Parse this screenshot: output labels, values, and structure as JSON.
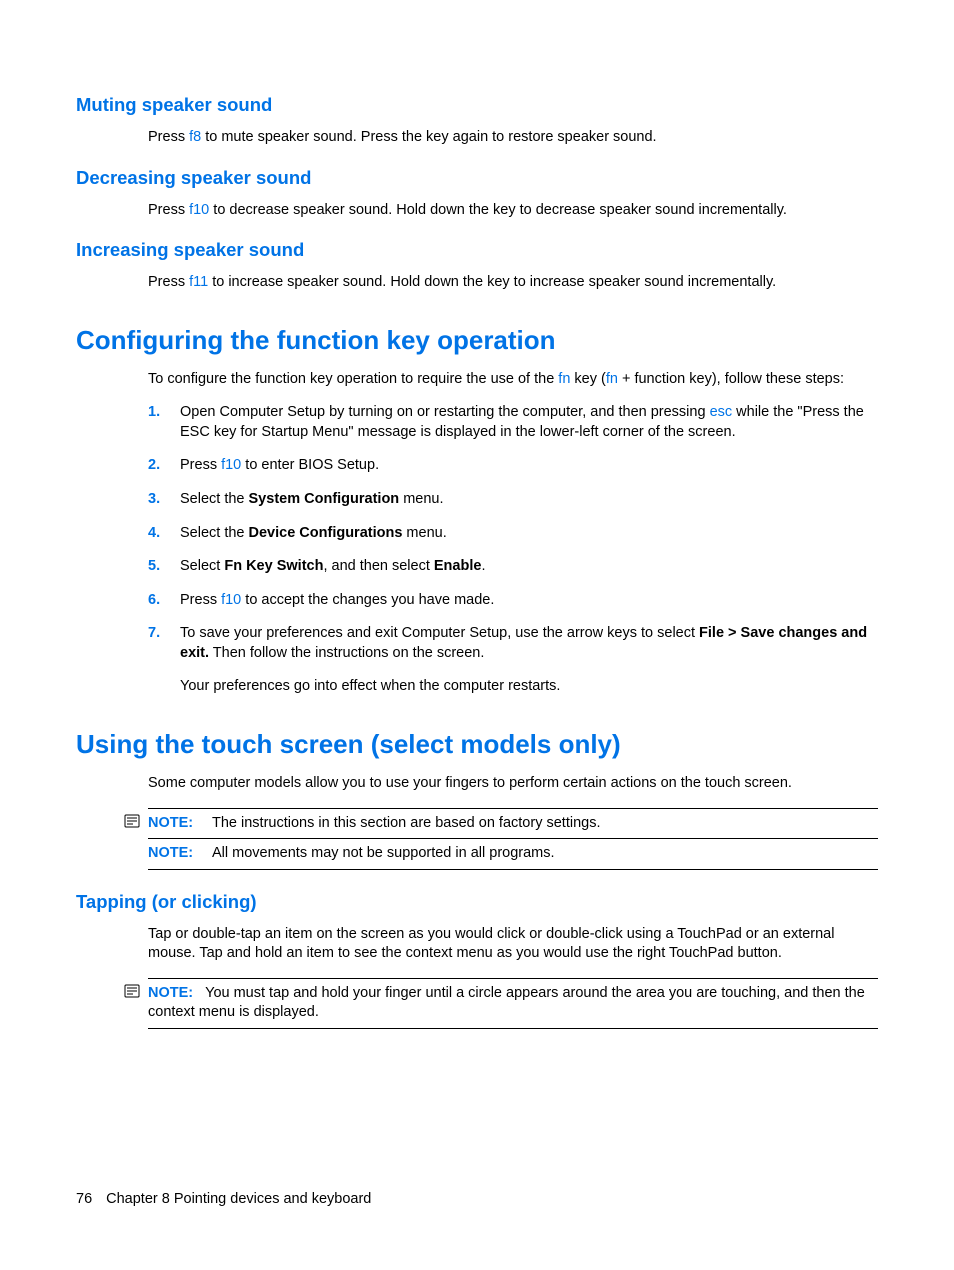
{
  "sections": {
    "muting": {
      "heading": "Muting speaker sound",
      "p1a": "Press ",
      "p1key": "f8",
      "p1b": " to mute speaker sound. Press the key again to restore speaker sound."
    },
    "decreasing": {
      "heading": "Decreasing speaker sound",
      "p1a": "Press ",
      "p1key": "f10",
      "p1b": " to decrease speaker sound. Hold down the key to decrease speaker sound incrementally."
    },
    "increasing": {
      "heading": "Increasing speaker sound",
      "p1a": "Press ",
      "p1key": "f11",
      "p1b": " to increase speaker sound. Hold down the key to increase speaker sound incrementally."
    },
    "configuring": {
      "heading": "Configuring the function key operation",
      "intro_a": "To configure the function key operation to require the use of the ",
      "intro_key1": "fn",
      "intro_b": " key (",
      "intro_key2": "fn",
      "intro_c": " + function key), follow these steps:",
      "steps": [
        {
          "num": "1.",
          "pre": "Open Computer Setup by turning on or restarting the computer, and then pressing ",
          "key": "esc",
          "post": " while the \"Press the ESC key for Startup Menu\" message is displayed in the lower-left corner of the screen."
        },
        {
          "num": "2.",
          "pre": "Press ",
          "key": "f10",
          "post": " to enter BIOS Setup."
        },
        {
          "num": "3.",
          "pre": "Select the ",
          "bold": "System Configuration",
          "post": " menu."
        },
        {
          "num": "4.",
          "pre": "Select the ",
          "bold": "Device Configurations",
          "post": " menu."
        },
        {
          "num": "5.",
          "pre": "Select ",
          "bold": "Fn Key Switch",
          "mid": ", and then select ",
          "bold2": "Enable",
          "post": "."
        },
        {
          "num": "6.",
          "pre": "Press ",
          "key": "f10",
          "post": " to accept the changes you have made."
        },
        {
          "num": "7.",
          "pre": "To save your preferences and exit Computer Setup, use the arrow keys to select ",
          "bold": "File > Save changes and exit.",
          "post": " Then follow the instructions on the screen."
        }
      ],
      "outro": "Your preferences go into effect when the computer restarts."
    },
    "touchscreen": {
      "heading": "Using the touch screen (select models only)",
      "intro": "Some computer models allow you to use your fingers to perform certain actions on the touch screen.",
      "note1_label": "NOTE:",
      "note1_text": "The instructions in this section are based on factory settings.",
      "note2_label": "NOTE:",
      "note2_text": "All movements may not be supported in all programs."
    },
    "tapping": {
      "heading": "Tapping (or clicking)",
      "p1": "Tap or double-tap an item on the screen as you would click or double-click using a TouchPad or an external mouse. Tap and hold an item to see the context menu as you would use the right TouchPad button.",
      "note_label": "NOTE:",
      "note_text": "You must tap and hold your finger until a circle appears around the area you are touching, and then the context menu is displayed."
    }
  },
  "footer": {
    "page": "76",
    "chapter": "Chapter 8   Pointing devices and keyboard"
  }
}
